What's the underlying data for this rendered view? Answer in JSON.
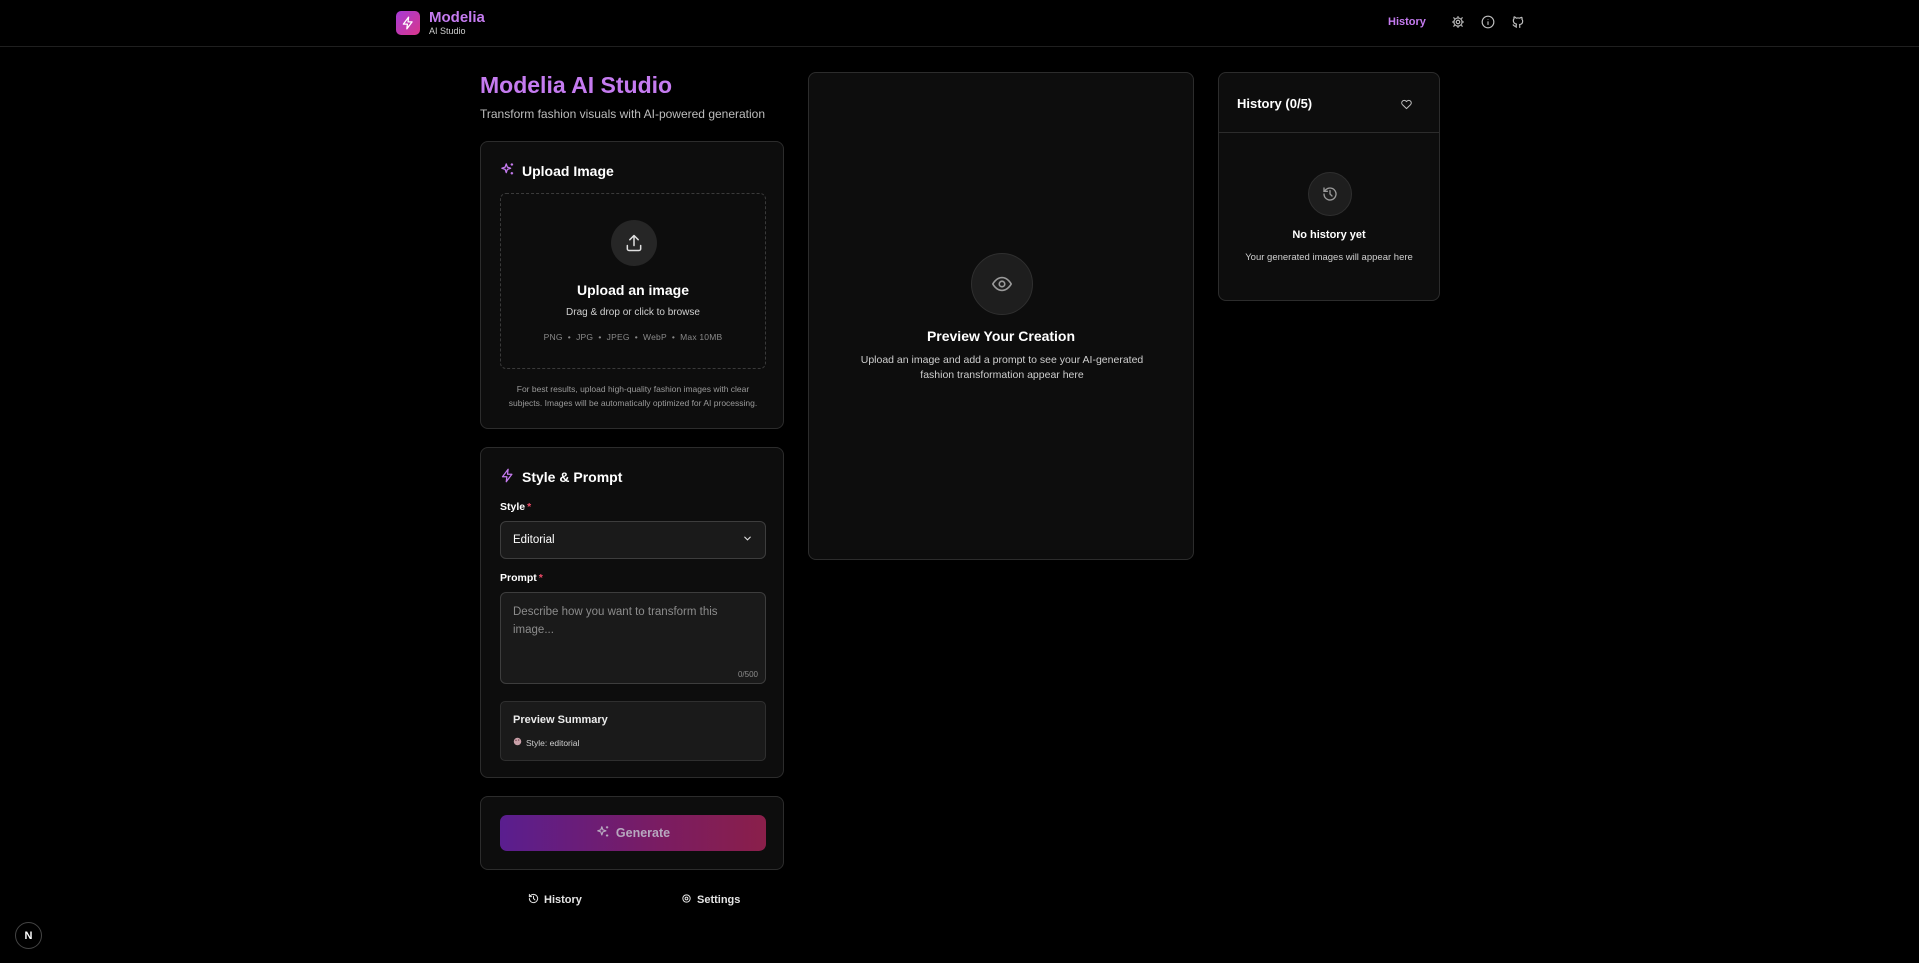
{
  "header": {
    "brand_name": "Modelia",
    "brand_sub": "AI Studio",
    "nav_history": "History",
    "icons": [
      "gear-icon",
      "info-icon",
      "github-icon"
    ]
  },
  "main": {
    "title": "Modelia AI Studio",
    "subtitle": "Transform fashion visuals with AI-powered generation"
  },
  "upload": {
    "heading": "Upload Image",
    "drop_title": "Upload an image",
    "drop_sub": "Drag & drop or click to browse",
    "formats": "PNG  •  JPG  •  JPEG  •  WebP  •  Max 10MB",
    "hint": "For best results, upload high-quality fashion images with clear subjects. Images will be automatically optimized for AI processing."
  },
  "style_prompt": {
    "heading": "Style & Prompt",
    "style_label": "Style",
    "style_value": "Editorial",
    "prompt_label": "Prompt",
    "required_mark": "*",
    "prompt_placeholder": "Describe how you want to transform this image...",
    "char_count": "0/500",
    "summary_title": "Preview Summary",
    "summary_style": "Style: editorial"
  },
  "generate": {
    "label": "Generate"
  },
  "footer_links": {
    "history": "History",
    "settings": "Settings"
  },
  "preview": {
    "title": "Preview Your Creation",
    "description": "Upload an image and add a prompt to see your AI-generated fashion transformation appear here"
  },
  "history_panel": {
    "title": "History (0/5)",
    "empty_title": "No history yet",
    "empty_sub": "Your generated images will appear here"
  },
  "badge": {
    "letter": "N"
  },
  "colors": {
    "accent": "#c57bf0",
    "background": "#000000",
    "card": "#0d0d0d",
    "required": "#ef4a67"
  }
}
